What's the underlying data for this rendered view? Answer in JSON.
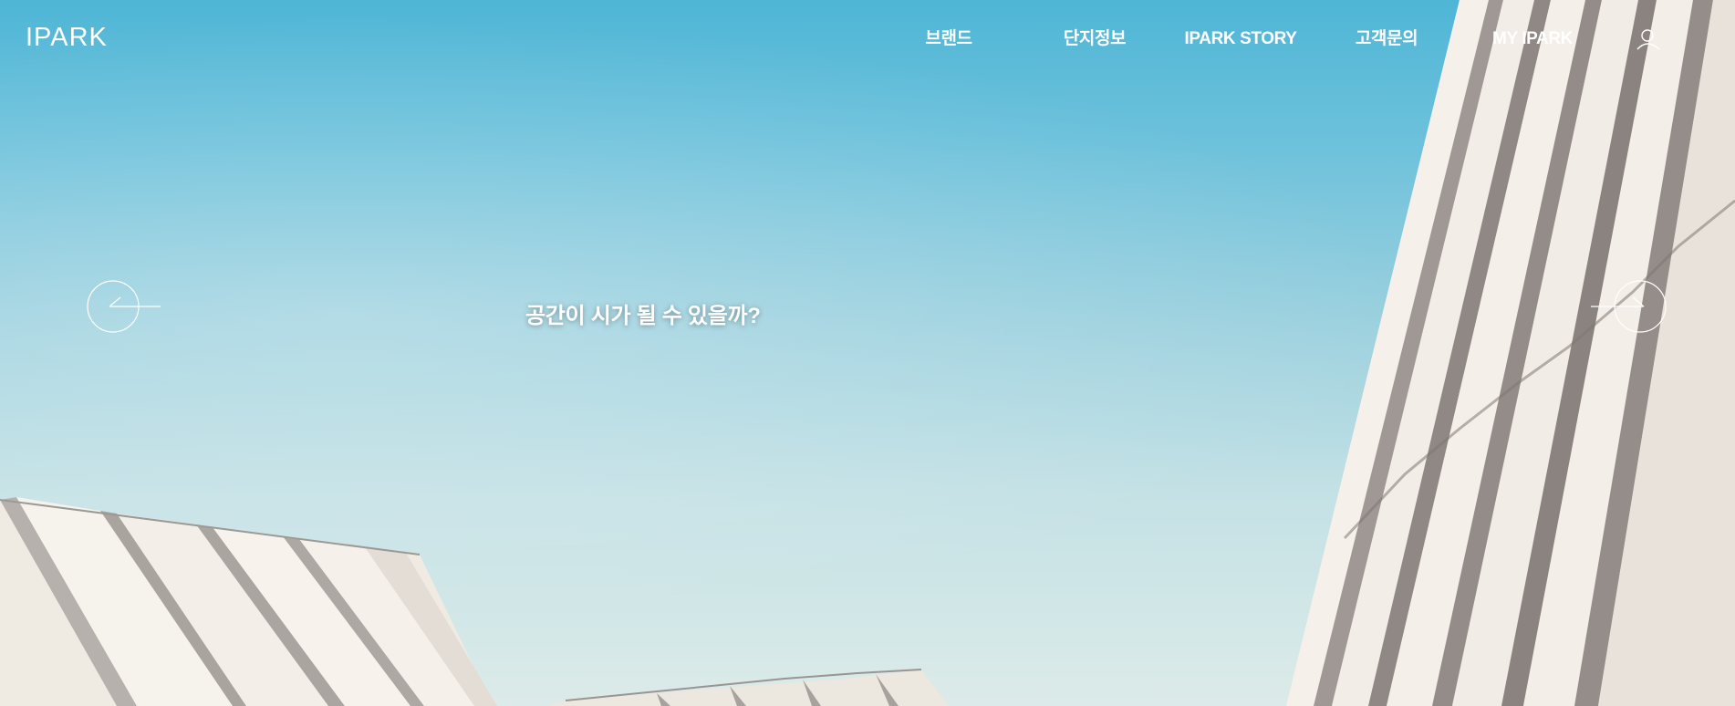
{
  "header": {
    "logo_text": "IPARK",
    "nav": [
      {
        "label": "브랜드"
      },
      {
        "label": "단지정보"
      },
      {
        "label": "IPARK STORY"
      },
      {
        "label": "고객문의"
      },
      {
        "label": "MY IPARK"
      }
    ],
    "search_icon": "search-icon"
  },
  "hero": {
    "headline": "공간이 시가 될 수 있을까?",
    "prev_icon": "arrow-left-icon",
    "next_icon": "arrow-right-icon"
  },
  "colors": {
    "sky_top": "#4fb6d6",
    "sky_bottom": "#dcebe9",
    "building_light": "#f4f0ea",
    "building_shadow": "#a9a4a2"
  }
}
